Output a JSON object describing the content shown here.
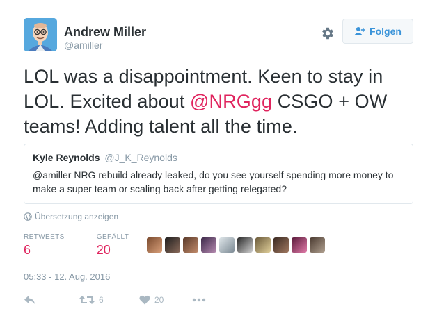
{
  "author": {
    "name": "Andrew Miller",
    "handle": "@amiller"
  },
  "header": {
    "settings_icon": "gear-icon",
    "follow_label": "Folgen"
  },
  "tweet": {
    "text_part1": "LOL was a disappointment. Keen to stay in LOL. Excited about ",
    "mention": "@NRGgg",
    "text_part2": " CSGO + OW teams! Adding talent all the time."
  },
  "quote": {
    "name": "Kyle Reynolds",
    "handle": "@J_K_Reynolds",
    "text": "@amiller NRG rebuild already leaked, do you see yourself spending more money to make a super team or scaling back after getting relegated?"
  },
  "translate_label": "Übersetzung anzeigen",
  "stats": {
    "retweets_label": "RETWEETS",
    "retweets_value": "6",
    "likes_label": "GEFÄLLT",
    "likes_value": "20"
  },
  "likers_count_shown": 10,
  "timestamp": "05:33 - 12. Aug. 2016",
  "actions": {
    "reply_icon": "reply-icon",
    "retweet_count": "6",
    "like_count": "20",
    "more_icon": "more-icon"
  },
  "colors": {
    "accent": "#e0245e",
    "follow_text": "#3b94d9",
    "muted": "#8899a6"
  }
}
